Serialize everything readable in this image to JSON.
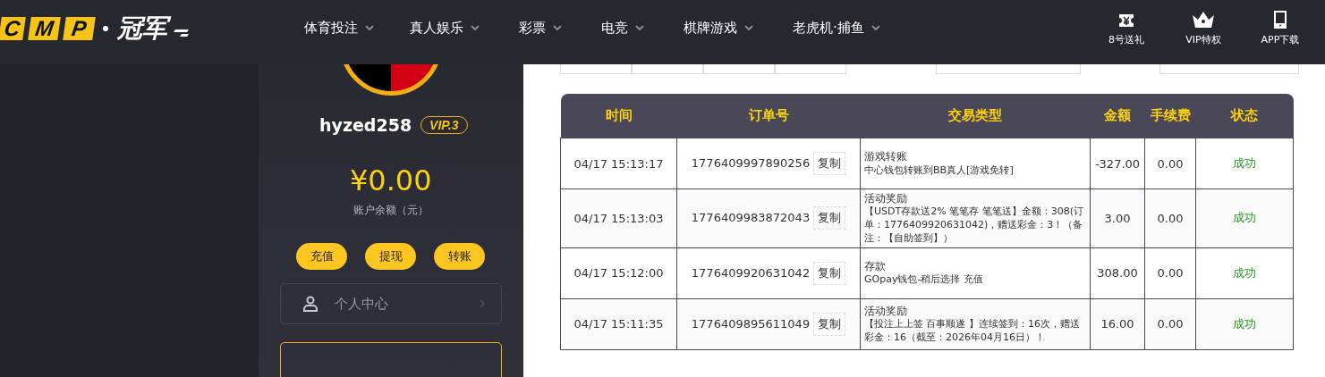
{
  "logo": {
    "letters": [
      "C",
      "M",
      "P"
    ],
    "name": "冠军"
  },
  "nav": [
    {
      "label": "体育投注"
    },
    {
      "label": "真人娱乐"
    },
    {
      "label": "彩票"
    },
    {
      "label": "电竞"
    },
    {
      "label": "棋牌游戏"
    },
    {
      "label": "老虎机·捕鱼"
    }
  ],
  "quick_links": [
    {
      "kind": "gift",
      "label": "8号送礼"
    },
    {
      "kind": "vip",
      "label": "VIP特权"
    },
    {
      "kind": "app",
      "label": "APP下载"
    }
  ],
  "profile": {
    "username": "hyzed258",
    "vip": "VIP.3",
    "balance": "¥0.00",
    "balance_label": "账户余额（元）",
    "actions": [
      "充值",
      "提现",
      "转账"
    ],
    "menu": [
      {
        "label": "个人中心",
        "selected": false
      },
      {
        "selected": true
      }
    ]
  },
  "table": {
    "columns": [
      "时间",
      "订单号",
      "交易类型",
      "金额",
      "手续费",
      "状态"
    ],
    "rows": [
      {
        "time": "04/17 15:13:17",
        "order": "1776409997890256",
        "copy_label": "复制",
        "type": "游戏转账",
        "detail": "中心钱包转账到BB真人[游戏免转]",
        "amount": "-327.00",
        "fee": "0.00",
        "status": "成功"
      },
      {
        "time": "04/17 15:13:03",
        "order": "1776409983872043",
        "copy_label": "复制",
        "type": "活动奖励",
        "detail": "【USDT存款送2% 笔笔存 笔笔送】金额：308(订单：1776409920631042)，赠送彩金：3！（备注：【自助签到】）",
        "amount": "3.00",
        "fee": "0.00",
        "status": "成功"
      },
      {
        "time": "04/17 15:12:00",
        "order": "1776409920631042",
        "copy_label": "复制",
        "type": "存款",
        "detail": "GOpay钱包-稍后选择 充值",
        "amount": "308.00",
        "fee": "0.00",
        "status": "成功"
      },
      {
        "time": "04/17 15:11:35",
        "order": "1776409895611049",
        "copy_label": "复制",
        "type": "活动奖励",
        "detail": "【投注上上签 百事顺遂 】连续签到：16次，赠送彩金：16（截至：2026年04月16日）！",
        "amount": "16.00",
        "fee": "0.00",
        "status": "成功"
      }
    ]
  }
}
